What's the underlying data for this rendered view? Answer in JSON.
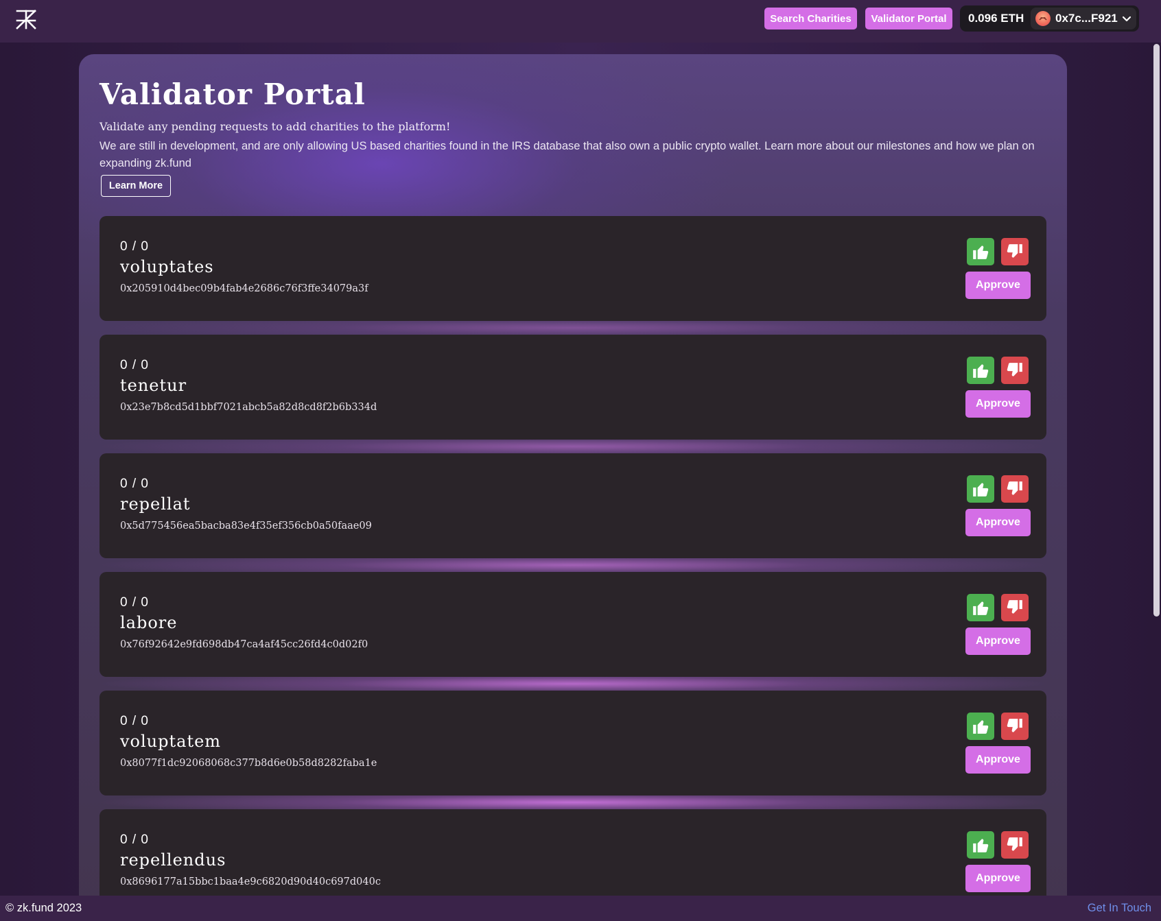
{
  "nav": {
    "logo_icon": "zk-fund-logo-icon",
    "search_label": "Search Charities",
    "validator_label": "Validator Portal",
    "balance": "0.096 ETH",
    "account": "0x7c...F921"
  },
  "header": {
    "title": "Validator Portal",
    "subtitle": "Validate any pending requests to add charities to the platform!",
    "description": "We are still in development, and are only allowing US based charities found in the IRS database that also own a public crypto wallet. Learn more about our milestones and how we plan on expanding zk.fund",
    "learn_more": "Learn More"
  },
  "requests": [
    {
      "votes": "0 / 0",
      "name": "voluptates",
      "address": "0x205910d4bec09b4fab4e2686c76f3ffe34079a3f",
      "approve": "Approve"
    },
    {
      "votes": "0 / 0",
      "name": "tenetur",
      "address": "0x23e7b8cd5d1bbf7021abcb5a82d8cd8f2b6b334d",
      "approve": "Approve"
    },
    {
      "votes": "0 / 0",
      "name": "repellat",
      "address": "0x5d775456ea5bacba83e4f35ef356cb0a50faae09",
      "approve": "Approve"
    },
    {
      "votes": "0 / 0",
      "name": "labore",
      "address": "0x76f92642e9fd698db47ca4af45cc26fd4c0d02f0",
      "approve": "Approve"
    },
    {
      "votes": "0 / 0",
      "name": "voluptatem",
      "address": "0x8077f1dc92068068c377b8d6e0b58d8282faba1e",
      "approve": "Approve"
    },
    {
      "votes": "0 / 0",
      "name": "repellendus",
      "address": "0x8696177a15bbc1baa4e9c6820d90d40c697d040c",
      "approve": "Approve"
    }
  ],
  "footer": {
    "copyright": "© zk.fund 2023",
    "contact": "Get In Touch"
  },
  "colors": {
    "accent": "#d46ee6",
    "approve_vote": "#4caf50",
    "reject_vote": "#d9484d",
    "link": "#6f8ee8"
  }
}
